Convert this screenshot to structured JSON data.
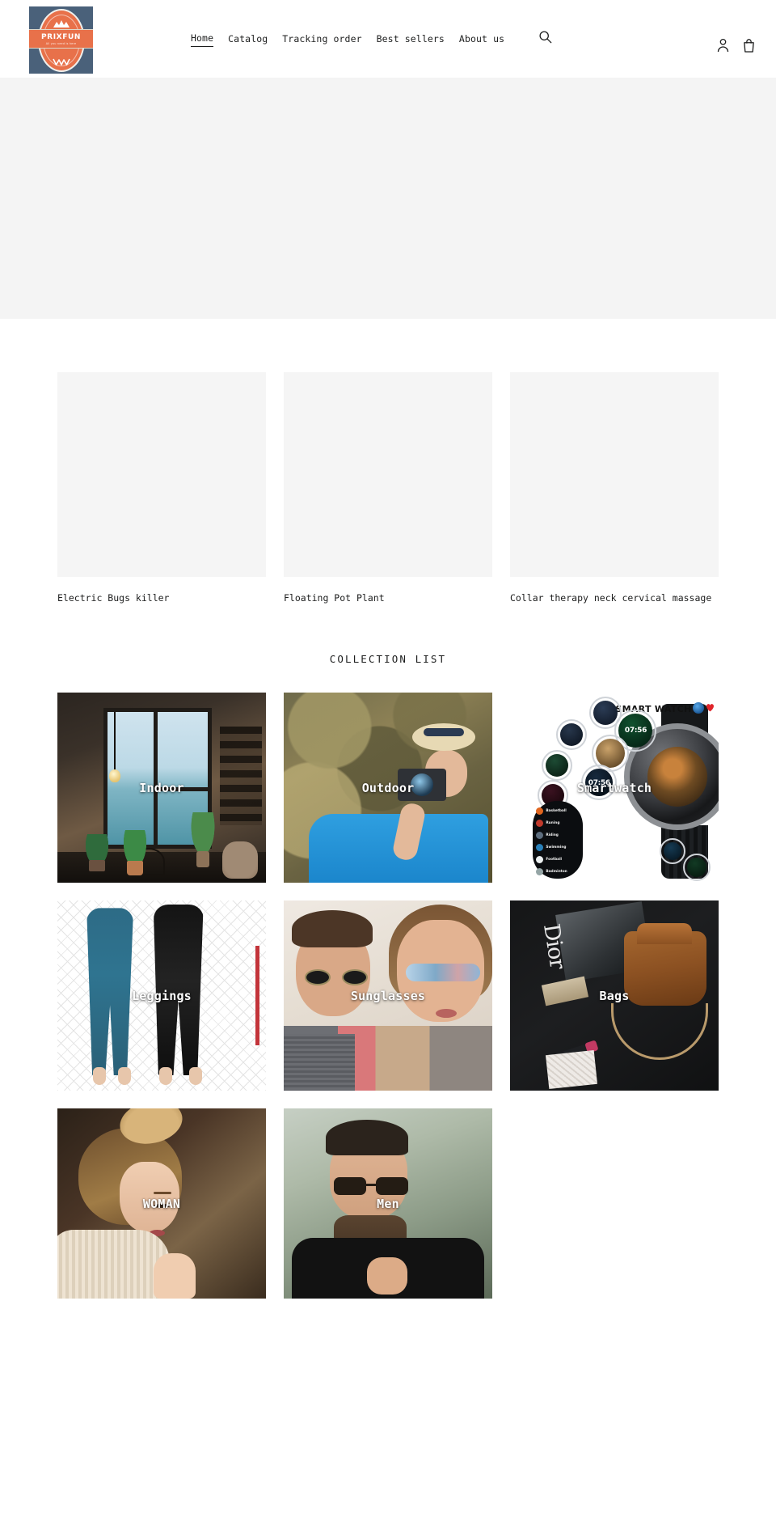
{
  "header": {
    "logo": {
      "name": "PRIXFUN",
      "tagline": "All you need is here",
      "mountain_icon": "mountain-icon",
      "wave_icon": "wave-icon",
      "bg_color": "#4a617a",
      "accent_color": "#e8714a"
    },
    "nav": [
      {
        "label": "Home",
        "active": true
      },
      {
        "label": "Catalog",
        "active": false
      },
      {
        "label": "Tracking order",
        "active": false
      },
      {
        "label": "Best sellers",
        "active": false
      },
      {
        "label": "About us",
        "active": false
      }
    ],
    "search_icon": "search-icon",
    "account_icon": "account-icon",
    "cart_icon": "cart-icon"
  },
  "hero": {
    "background_color": "#f4f4f4"
  },
  "featured": {
    "products": [
      {
        "title": "Electric Bugs killer"
      },
      {
        "title": "Floating Pot Plant"
      },
      {
        "title": "Collar therapy neck cervical massage"
      }
    ]
  },
  "collections": {
    "title": "COLLECTION LIST",
    "items": [
      {
        "label": "Indoor"
      },
      {
        "label": "Outdoor"
      },
      {
        "label": "Smartwatch"
      },
      {
        "label": "Leggings"
      },
      {
        "label": "Sunglasses"
      },
      {
        "label": "Bags"
      },
      {
        "label": "WOMAN"
      },
      {
        "label": "Men"
      }
    ]
  },
  "smartwatch_art": {
    "heading": "SMART WATCH",
    "time_large": "07:56",
    "time_small": "07:56",
    "sport_modes": [
      {
        "name": "Basketball",
        "color": "#e0651f"
      },
      {
        "name": "Runing",
        "color": "#c0392b"
      },
      {
        "name": "Riding",
        "color": "#5d6d7e"
      },
      {
        "name": "Swimming",
        "color": "#2980b9"
      },
      {
        "name": "Football",
        "color": "#ecf0f1"
      },
      {
        "name": "Badminton",
        "color": "#95a5a6"
      }
    ],
    "bluetooth_badge": "bluetooth-icon",
    "heart_badge": "heart-icon"
  },
  "bags_art": {
    "magazine_title": "Dior"
  }
}
